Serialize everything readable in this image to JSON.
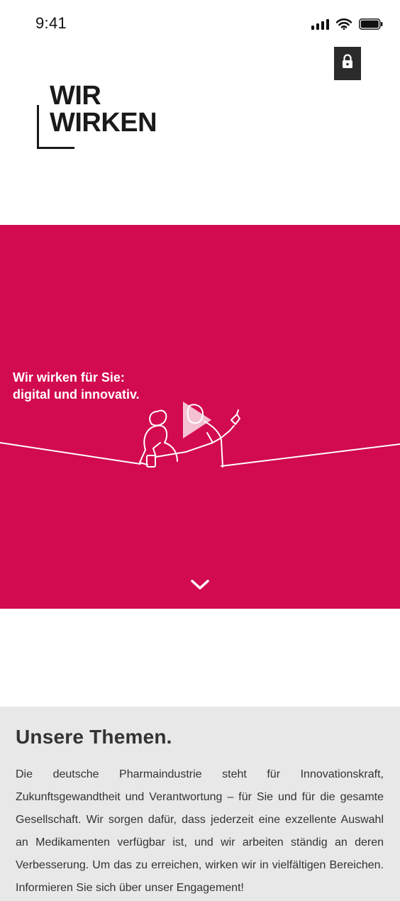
{
  "status_bar": {
    "time": "9:41",
    "icons": [
      "cellular-signal-icon",
      "wifi-icon",
      "battery-icon"
    ]
  },
  "header": {
    "logo_line1": "WIR",
    "logo_line2": "WIRKEN",
    "lock_icon": "lock-icon"
  },
  "hero": {
    "headline_line1": "Wir wirken für Sie:",
    "headline_line2": "digital und innovativ.",
    "background_color": "#d20a4f",
    "play_icon": "play-icon",
    "scroll_icon": "chevron-down-icon"
  },
  "topics": {
    "title": "Unsere Themen.",
    "text": "Die deutsche Pharmaindustrie steht für Innovationskraft, Zukunftsgewandtheit und Verantwortung – für Sie und für die gesamte Gesellschaft. Wir sorgen dafür, dass jederzeit eine exzellente Auswahl an Medikamenten verfügbar ist, und wir arbeiten ständig an deren Verbesserung. Um das zu erreichen, wirken wir in vielfältigen Bereichen. Informieren Sie sich über unser Engagement!",
    "background_color": "#e8e8e8"
  }
}
